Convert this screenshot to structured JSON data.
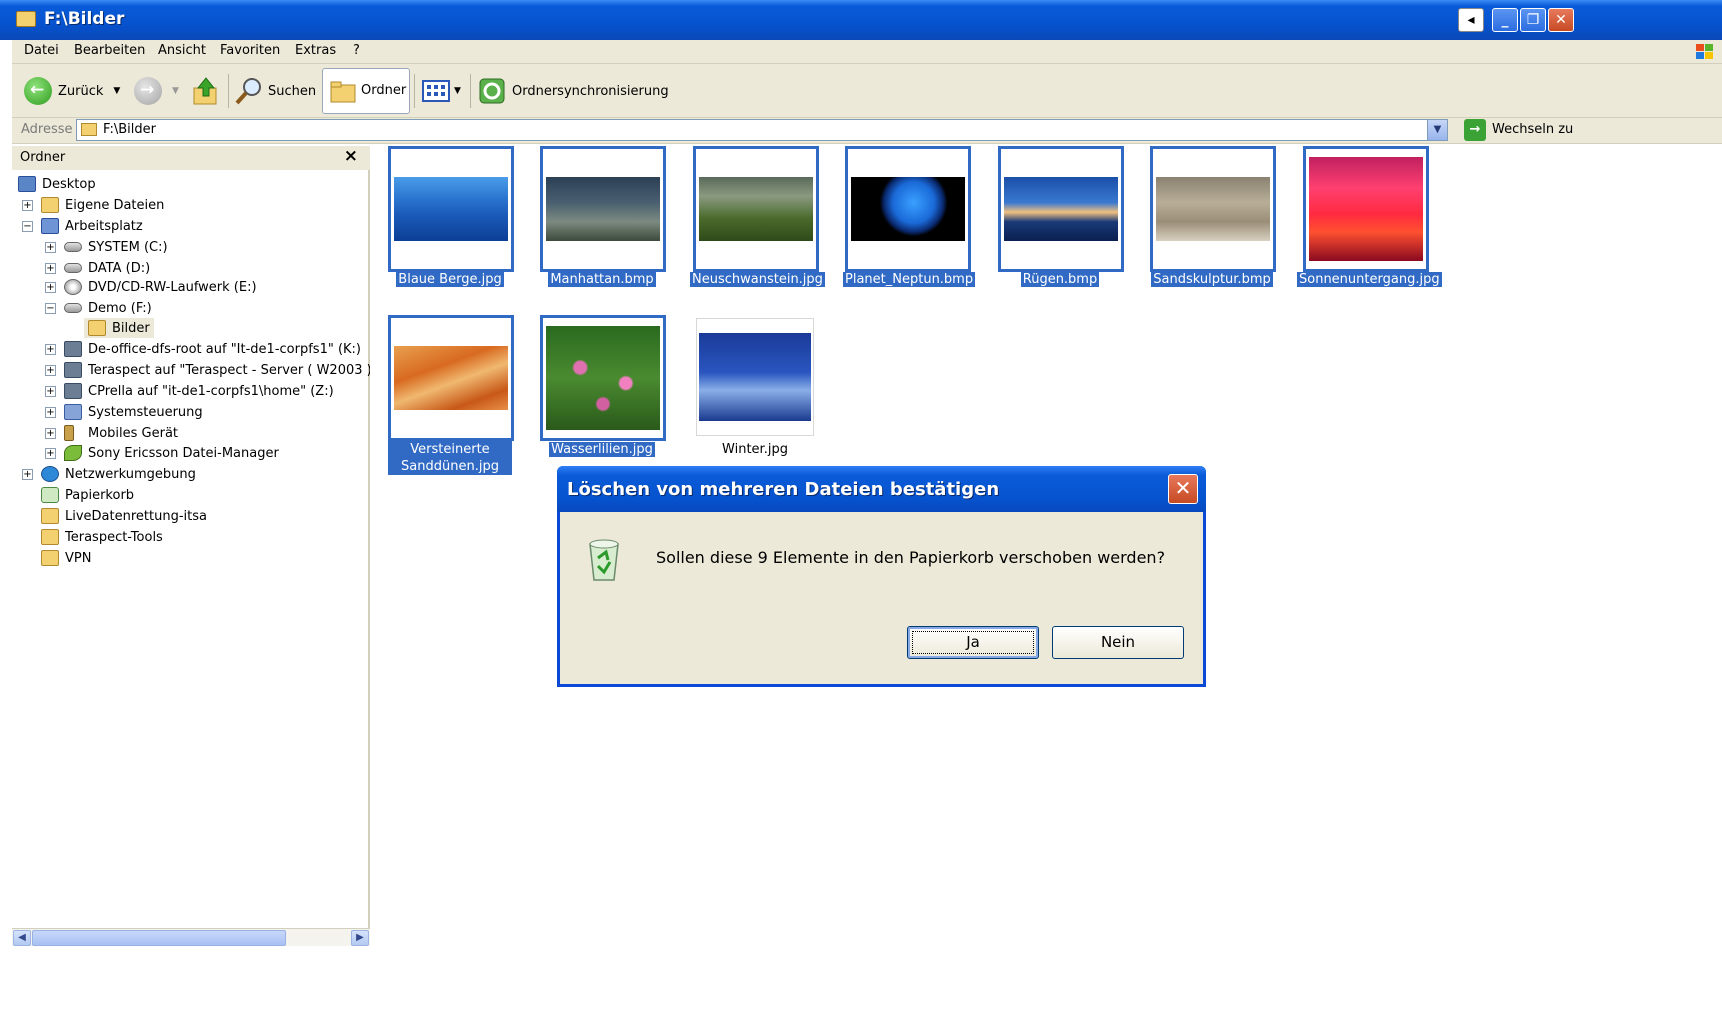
{
  "window": {
    "title": "F:\\Bilder"
  },
  "menu": [
    "Datei",
    "Bearbeiten",
    "Ansicht",
    "Favoriten",
    "Extras",
    "?"
  ],
  "toolbar": {
    "back": "Zurück",
    "search": "Suchen",
    "folders": "Ordner",
    "sync": "Ordnersynchronisierung"
  },
  "address": {
    "label": "Adresse",
    "value": "F:\\Bilder",
    "go": "Wechseln zu"
  },
  "folder_pane": {
    "title": "Ordner",
    "items": [
      "Desktop",
      "Eigene Dateien",
      "Arbeitsplatz",
      "SYSTEM (C:)",
      "DATA (D:)",
      "DVD/CD-RW-Laufwerk (E:)",
      "Demo (F:)",
      "Bilder",
      "De-office-dfs-root auf \"It-de1-corpfs1\" (K:)",
      "Teraspect auf \"Teraspect - Server ( W2003 ) (It",
      "CPrella auf \"it-de1-corpfs1\\home\" (Z:)",
      "Systemsteuerung",
      "Mobiles Gerät",
      "Sony Ericsson Datei-Manager",
      "Netzwerkumgebung",
      "Papierkorb",
      "LiveDatenrettung-itsa",
      "Teraspect-Tools",
      "VPN"
    ]
  },
  "files": [
    {
      "name": "Blaue Berge.jpg",
      "selected": true
    },
    {
      "name": "Manhattan.bmp",
      "selected": true
    },
    {
      "name": "Neuschwanstein.jpg",
      "selected": true
    },
    {
      "name": "Planet_Neptun.bmp",
      "selected": true
    },
    {
      "name": "Rügen.bmp",
      "selected": true
    },
    {
      "name": "Sandskulptur.bmp",
      "selected": true
    },
    {
      "name": "Sonnenuntergang.jpg",
      "selected": true
    },
    {
      "name_line1": "Versteinerte",
      "name_line2": "Sanddünen.jpg",
      "selected": true
    },
    {
      "name": "Wasserlilien.jpg",
      "selected": true
    },
    {
      "name": "Winter.jpg",
      "selected": false
    }
  ],
  "dialog": {
    "title": "Löschen von mehreren Dateien bestätigen",
    "message": "Sollen diese 9 Elemente in den Papierkorb verschoben werden?",
    "yes": "Ja",
    "no": "Nein"
  },
  "colors": {
    "xp_blue": "#0653cf",
    "selection": "#316ac5",
    "chrome": "#ece9d8"
  }
}
